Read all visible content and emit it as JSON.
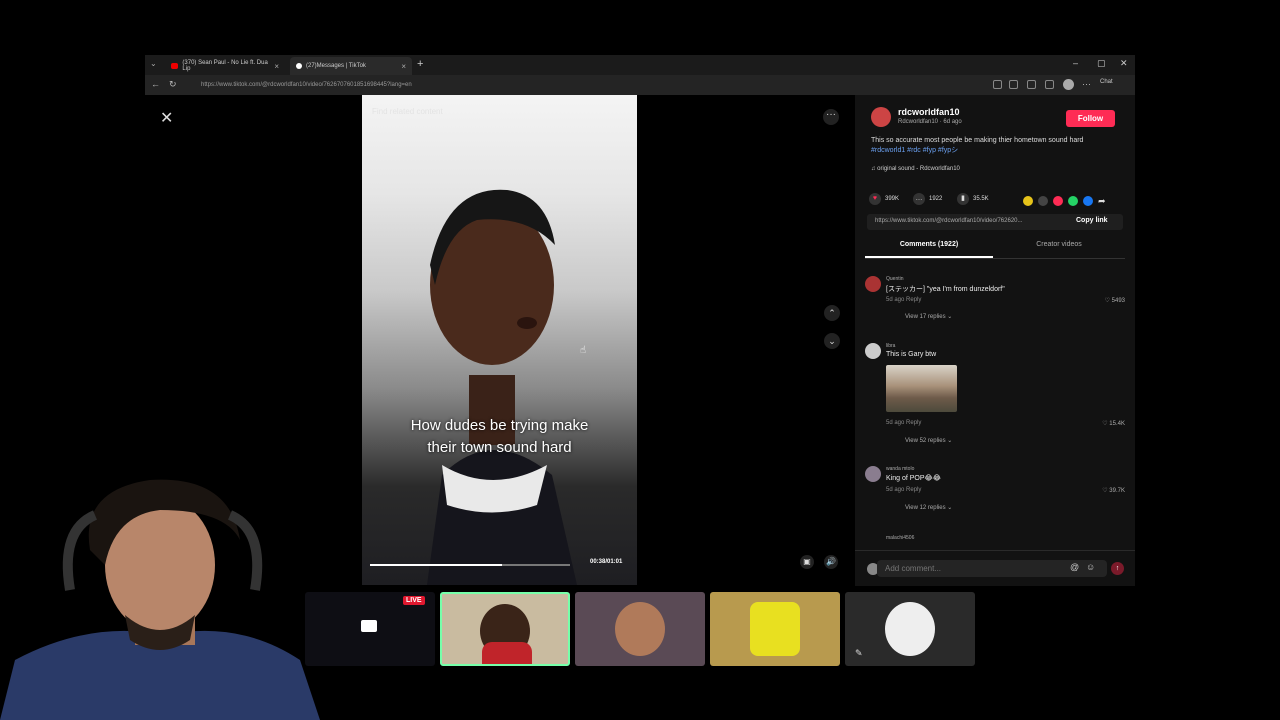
{
  "browser": {
    "tabs": [
      {
        "label": "(370) Sean Paul - No Lie ft. Dua Lip"
      },
      {
        "label": "(27)Messages | TikTok"
      }
    ],
    "new_tab": "+",
    "url": "https://www.tiktok.com/@rdcworldfan10/video/7626707601851698445?lang=en",
    "chat_label": "Chat"
  },
  "video": {
    "search_placeholder": "Find related content",
    "caption_line1": "How dudes be trying make",
    "caption_line2": "their town sound hard",
    "timecode": "00:38/01:01",
    "progress": 0.66
  },
  "post": {
    "author_name": "rdcworldfan10",
    "author_sub": "Rdcworldfan10 · 6d ago",
    "follow_label": "Follow",
    "description": "This so accurate most people be making thier hometown sound hard",
    "hashtags": "#rdcworld1 #rdc #fyp #fypシ",
    "sound": "♫  original sound - Rdcworldfan10",
    "likes": "399K",
    "comments_count": "1922",
    "saves": "35.5K",
    "link": "https://www.tiktok.com/@rdcworldfan10/video/762620...",
    "copy_link_label": "Copy link",
    "tab_comments": "Comments (1922)",
    "tab_creator": "Creator videos"
  },
  "comments": [
    {
      "user": "Quentin",
      "text": "[ステッカー] \"yea I'm from dunzeldorf\"",
      "meta": "5d ago   Reply",
      "likes": "♡ 5493",
      "replies": "View 17 replies ⌄"
    },
    {
      "user": "libra",
      "text": "This is Gary btw",
      "meta": "5d ago   Reply",
      "likes": "♡ 15.4K",
      "replies": "View 52 replies ⌄"
    },
    {
      "user": "wanda mtolo",
      "text": "King of POP😂😂",
      "meta": "5d ago   Reply",
      "likes": "♡ 39.7K",
      "replies": "View 12 replies ⌄"
    },
    {
      "user": "malachi4506"
    }
  ],
  "add_comment_placeholder": "Add comment...",
  "call": {
    "live_badge": "LIVE"
  },
  "colors": {
    "accent": "#fe2c55",
    "hashtag": "#6ba0f0"
  }
}
